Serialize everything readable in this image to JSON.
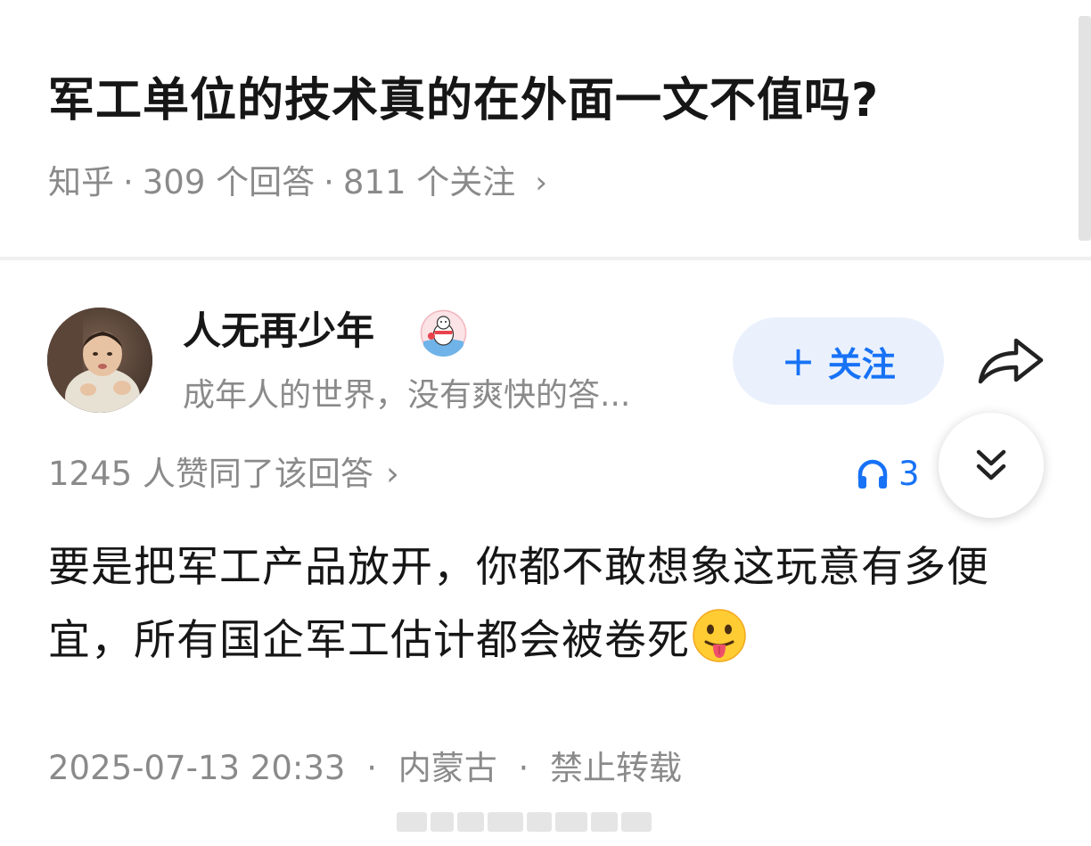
{
  "question": {
    "title": "军工单位的技术真的在外面一文不值吗?",
    "source": "知乎",
    "answers": "309 个回答",
    "followers": "811 个关注",
    "chevron": "›"
  },
  "author": {
    "name": "人无再少年",
    "bio": "成年人的世界，没有爽快的答...",
    "follow_label": "关注",
    "follow_plus": "+"
  },
  "answer": {
    "votes": "1245 人赞同了该回答",
    "votes_chevron": "›",
    "listen_count": "3",
    "text": "要是把军工产品放开，你都不敢想象这玩意有多便宜，所有国企军工估计都会被卷死",
    "emoji": "face-with-tongue",
    "date": "2025-07-13 20:33",
    "location": "内蒙古",
    "copyright": "禁止转载"
  },
  "colors": {
    "accent": "#1772f6",
    "follow_bg": "#eaf1fd",
    "muted_text": "#8a8a8a",
    "title_text": "#161616"
  },
  "icons": [
    "share-icon",
    "headphone-icon",
    "double-chevron-down-icon",
    "chevron-right-icon",
    "author-badge-icon"
  ]
}
